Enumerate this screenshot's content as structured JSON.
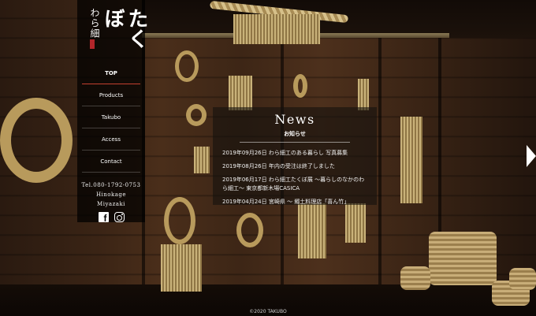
{
  "logo": {
    "small_text": "わら細",
    "large_text": "たくぼ"
  },
  "nav": {
    "items": [
      {
        "label": "TOP",
        "active": true
      },
      {
        "label": "Products"
      },
      {
        "label": "Takubo"
      },
      {
        "label": "Access"
      },
      {
        "label": "Contact"
      }
    ],
    "contact_lines": [
      "Tel.080-1792-0753",
      "Hinokage",
      "Miyazaki"
    ],
    "social": [
      "facebook-icon",
      "instagram-icon"
    ]
  },
  "news": {
    "title": "News",
    "subtitle": "お知らせ",
    "items": [
      "2019年09月26日 わら細工のある暮らし 写真募集",
      "2019年08月26日 年内の受注は終了しました",
      "2019年06月17日 わら細工たくぼ展 ～暮らしのなかのわら細工～ 東京都新木場CASICA",
      "2019年04月24日 宮崎県 ～ 郷土料理店「喜ん竹」"
    ]
  },
  "footer": {
    "copyright": "©2020 TAKUBO"
  },
  "colors": {
    "panel": "#000000",
    "active_underline": "#c4402f",
    "straw": "#c9b27a"
  }
}
